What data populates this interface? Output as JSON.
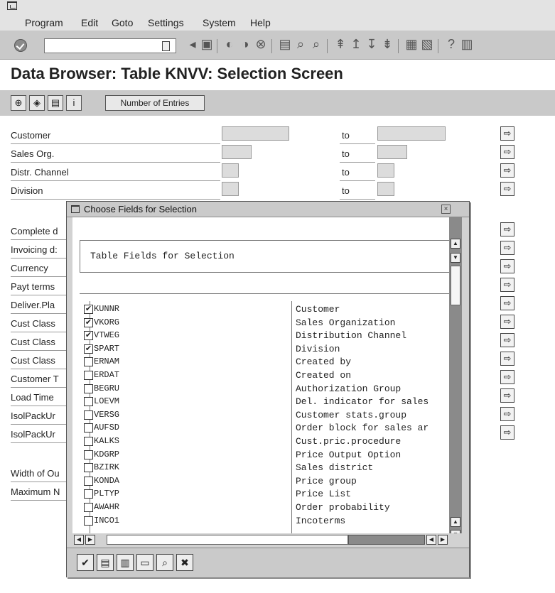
{
  "menu": [
    "Program",
    "Edit",
    "Goto",
    "Settings",
    "System",
    "Help"
  ],
  "title": "Data Browser: Table KNVV: Selection Screen",
  "app_toolbar": {
    "entries_label": "Number of Entries"
  },
  "to_label": "to",
  "selection_rows": [
    {
      "label": "Customer",
      "to": "to"
    },
    {
      "label": "Sales Org.",
      "to": "to"
    },
    {
      "label": "Distr. Channel",
      "to": "to"
    },
    {
      "label": "Division",
      "to": "to"
    },
    {
      "label": "Complete d"
    },
    {
      "label": "Invoicing d:"
    },
    {
      "label": "Currency"
    },
    {
      "label": "Payt terms"
    },
    {
      "label": "Deliver.Pla"
    },
    {
      "label": "Cust Class"
    },
    {
      "label": "Cust Class"
    },
    {
      "label": "Cust Class"
    },
    {
      "label": "Customer T"
    },
    {
      "label": "Load Time"
    },
    {
      "label": "IsolPackUr"
    },
    {
      "label": "IsolPackUr"
    },
    {
      "label": "Width of Ou"
    },
    {
      "label": "Maximum N"
    }
  ],
  "dialog": {
    "title": "Choose Fields for Selection",
    "group_title": "Table Fields for Selection",
    "fields": [
      {
        "name": "KUNNR",
        "desc": "Customer",
        "checked": true
      },
      {
        "name": "VKORG",
        "desc": "Sales Organization",
        "checked": true
      },
      {
        "name": "VTWEG",
        "desc": "Distribution Channel",
        "checked": true
      },
      {
        "name": "SPART",
        "desc": "Division",
        "checked": true
      },
      {
        "name": "ERNAM",
        "desc": "Created by",
        "checked": false
      },
      {
        "name": "ERDAT",
        "desc": "Created on",
        "checked": false
      },
      {
        "name": "BEGRU",
        "desc": "Authorization Group",
        "checked": false
      },
      {
        "name": "LOEVM",
        "desc": "Del. indicator for sales",
        "checked": false
      },
      {
        "name": "VERSG",
        "desc": "Customer stats.group",
        "checked": false
      },
      {
        "name": "AUFSD",
        "desc": "Order block for sales ar",
        "checked": false
      },
      {
        "name": "KALKS",
        "desc": "Cust.pric.procedure",
        "checked": false
      },
      {
        "name": "KDGRP",
        "desc": "Price Output Option",
        "checked": false
      },
      {
        "name": "BZIRK",
        "desc": "Sales district",
        "checked": false
      },
      {
        "name": "KONDA",
        "desc": "Price group",
        "checked": false
      },
      {
        "name": "PLTYP",
        "desc": "Price List",
        "checked": false
      },
      {
        "name": "AWAHR",
        "desc": "Order probability",
        "checked": false
      },
      {
        "name": "INCO1",
        "desc": "Incoterms",
        "checked": false
      }
    ]
  }
}
